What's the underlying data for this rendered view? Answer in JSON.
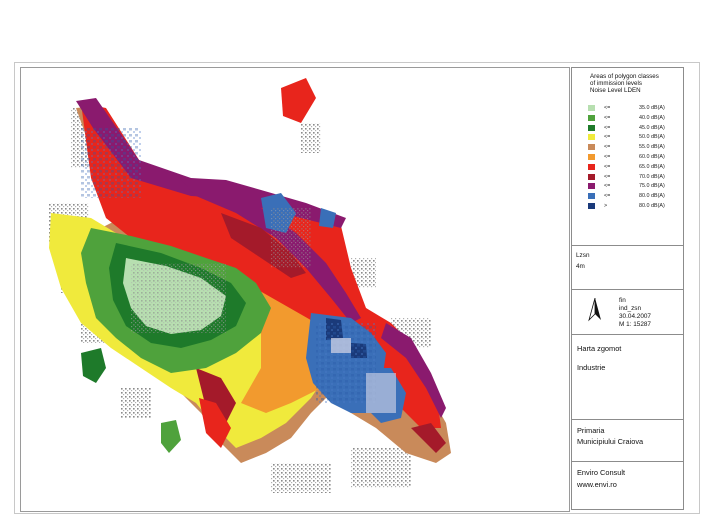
{
  "legend": {
    "title_lines": [
      "Areas of polygon classes",
      "of immission levels",
      "Noise Level LDEN"
    ],
    "classes": [
      {
        "op": "<=",
        "value": "35.0 dB(A)",
        "color": "#b7dfb0"
      },
      {
        "op": "<=",
        "value": "40.0 dB(A)",
        "color": "#4fa23c"
      },
      {
        "op": "<=",
        "value": "45.0 dB(A)",
        "color": "#1e7a2a"
      },
      {
        "op": "<=",
        "value": "50.0 dB(A)",
        "color": "#f0ea3c"
      },
      {
        "op": "<=",
        "value": "55.0 dB(A)",
        "color": "#c98a5a"
      },
      {
        "op": "<=",
        "value": "60.0 dB(A)",
        "color": "#f29a2e"
      },
      {
        "op": "<=",
        "value": "65.0 dB(A)",
        "color": "#e8251c"
      },
      {
        "op": "<=",
        "value": "70.0 dB(A)",
        "color": "#a41a2a"
      },
      {
        "op": "<=",
        "value": "75.0 dB(A)",
        "color": "#8a1a6e"
      },
      {
        "op": "<=",
        "value": "80.0 dB(A)",
        "color": "#3a6fb8"
      },
      {
        "op": ">",
        "value": "80.0 dB(A)",
        "color": "#1a3a7a"
      }
    ]
  },
  "indicator": {
    "label": "Lzsn",
    "height": "4m"
  },
  "file": {
    "line1": "fin",
    "line2": "ind_zsn",
    "date": "30.04.2007",
    "scale": "M 1:  15287"
  },
  "map_title": {
    "title": "Harta zgomot",
    "subtitle": "Industrie"
  },
  "client": {
    "line1": "Primaria",
    "line2": "Municipiului Craiova"
  },
  "company": {
    "name": "Enviro Consult",
    "web": "www.envi.ro"
  }
}
